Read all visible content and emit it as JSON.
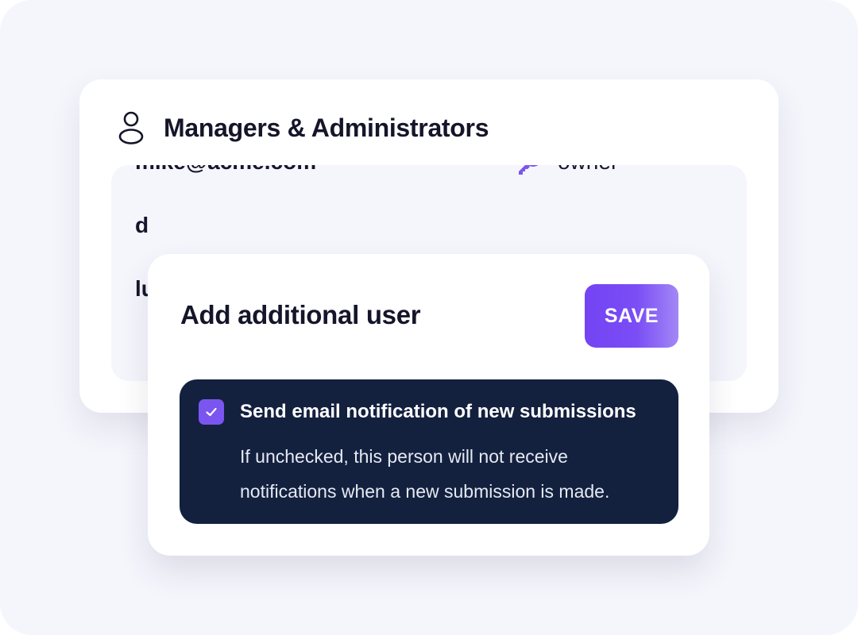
{
  "managers_card": {
    "title": "Managers & Administrators",
    "icon": "user-icon",
    "users": [
      {
        "email": "lu",
        "role": ""
      },
      {
        "email": "d",
        "role": ""
      },
      {
        "email": "mike@acme.com",
        "role": "owner",
        "role_icon": "key-icon"
      }
    ]
  },
  "modal": {
    "title": "Add additional user",
    "save_label": "SAVE",
    "notification": {
      "checked": true,
      "label": "Send email notification of new submissions",
      "help_line_1": "If unchecked, this person will not receive",
      "help_line_2": "notifications when a new submission is made."
    }
  },
  "colors": {
    "background": "#f5f6fc",
    "text": "#15152a",
    "accent": "#7444f4",
    "notice_bg": "#13213f"
  }
}
